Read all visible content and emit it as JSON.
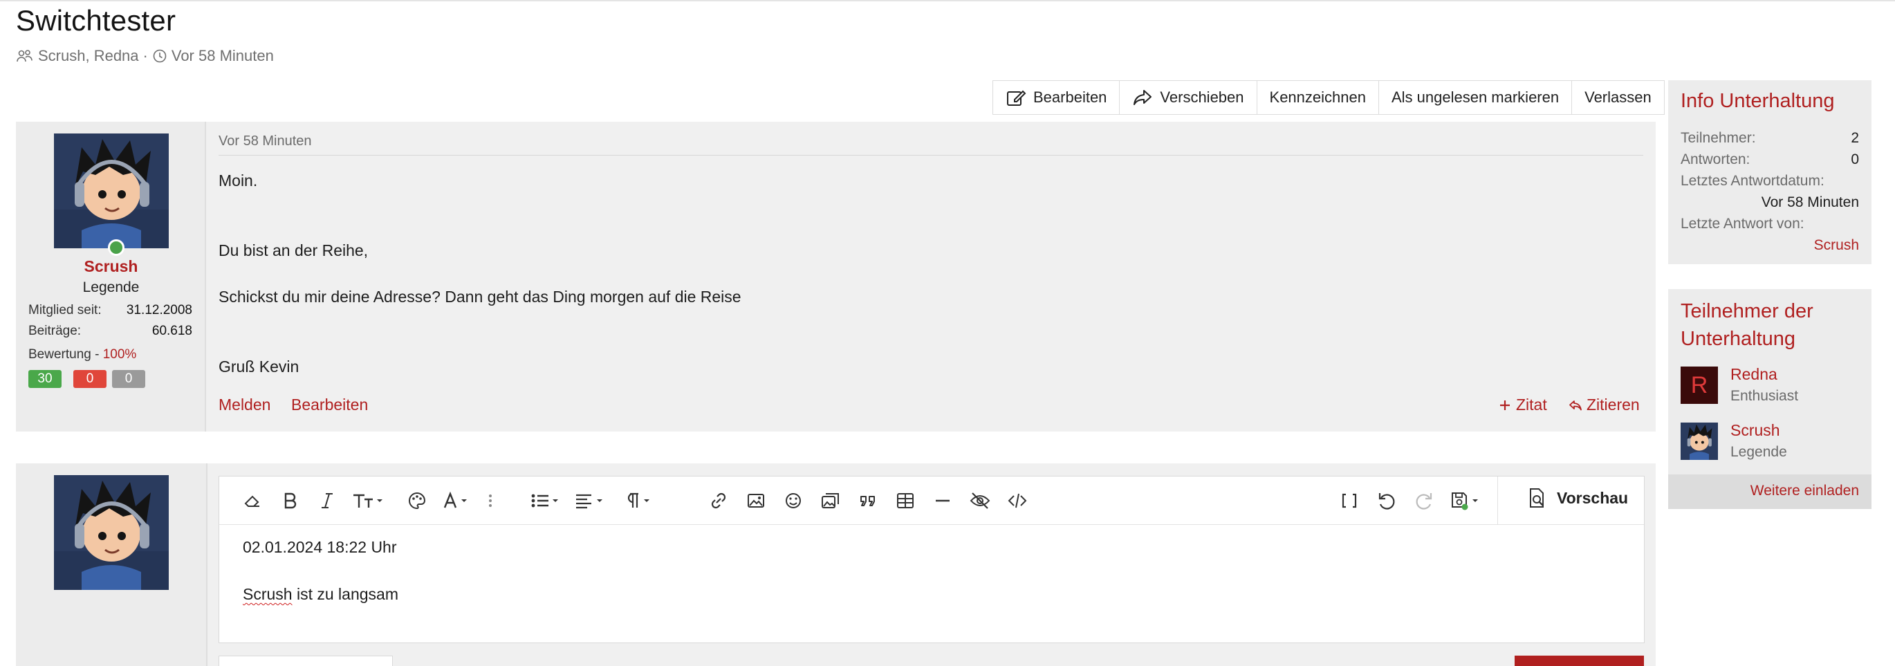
{
  "thread": {
    "title": "Switchtester",
    "participants": "Scrush, Redna",
    "time": "Vor 58 Minuten"
  },
  "actions": {
    "edit": "Bearbeiten",
    "move": "Verschieben",
    "mark": "Kennzeichnen",
    "unread": "Als ungelesen markieren",
    "leave": "Verlassen"
  },
  "post": {
    "user": {
      "name": "Scrush",
      "title": "Legende",
      "joined_label": "Mitglied seit:",
      "joined": "31.12.2008",
      "posts_label": "Beiträge:",
      "posts": "60.618",
      "rating_label": "Bewertung",
      "rating_sep": " - ",
      "rating_value": "100%",
      "positive": "30",
      "negative": "0",
      "neutral": "0"
    },
    "date": "Vor 58 Minuten",
    "lines": [
      "Moin.",
      "Du bist an der Reihe,",
      "Schickst du mir deine Adresse? Dann geht das Ding morgen auf die Reise",
      "Gruß Kevin"
    ],
    "report": "Melden",
    "edit": "Bearbeiten",
    "quote_add": "Zitat",
    "quote": "Zitieren"
  },
  "editor": {
    "preview": "Vorschau",
    "line1": "02.01.2024 18:22 Uhr",
    "line2_word": "Scrush",
    "line2_rest": " ist zu langsam"
  },
  "info": {
    "heading": "Info Unterhaltung",
    "participants_label": "Teilnehmer:",
    "participants": "2",
    "replies_label": "Antworten:",
    "replies": "0",
    "last_date_label": "Letztes Antwortdatum:",
    "last_date": "Vor 58 Minuten",
    "last_by_label": "Letzte Antwort von:",
    "last_by": "Scrush"
  },
  "members": {
    "heading_line1": "Teilnehmer der",
    "heading_line2": "Unterhaltung",
    "list": [
      {
        "initial": "R",
        "name": "Redna",
        "role": "Enthusiast"
      },
      {
        "name": "Scrush",
        "role": "Legende"
      }
    ],
    "invite": "Weitere einladen"
  },
  "colors": {
    "accent": "#b02020",
    "positive": "#4aa84a",
    "negative": "#e0463a",
    "neutral": "#9a9a9a",
    "panel": "#ececec"
  }
}
